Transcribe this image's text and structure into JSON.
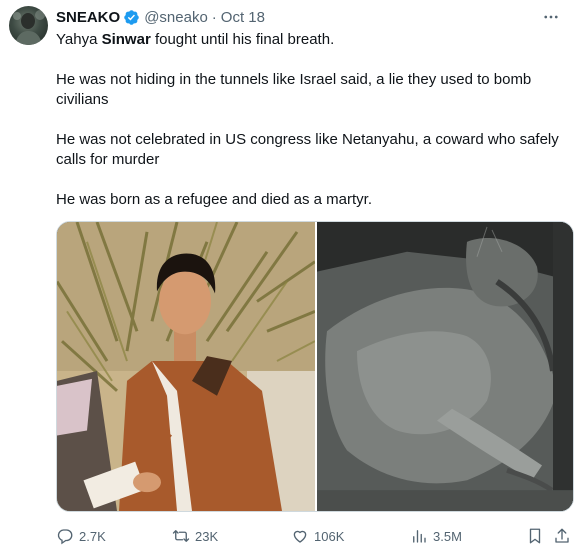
{
  "tweet": {
    "author": {
      "display_name": "SNEAKO",
      "verified_icon": "verified-badge-icon",
      "handle": "@sneako",
      "separator": "·",
      "timestamp": "Oct 18"
    },
    "more_icon": "more-horizontal-icon",
    "body": {
      "line1_prefix": "Yahya ",
      "line1_bold": "Sinwar",
      "line1_suffix": " fought until his final breath.",
      "paragraph2": "He was not hiding in the tunnels like Israel said, a lie they used to bomb civilians",
      "paragraph3": "He was not celebrated in US congress like Netanyahu, a coward who safely calls for murder",
      "paragraph4": "He was born as a refugee and died as a martyr."
    },
    "media": {
      "count": 2
    },
    "actions": {
      "reply": {
        "icon": "reply-icon",
        "count": "2.7K"
      },
      "retweet": {
        "icon": "retweet-icon",
        "count": "23K"
      },
      "like": {
        "icon": "heart-icon",
        "count": "106K"
      },
      "views": {
        "icon": "views-icon",
        "count": "3.5M"
      },
      "bookmark": {
        "icon": "bookmark-icon"
      },
      "share": {
        "icon": "share-icon"
      }
    },
    "colors": {
      "text": "#0f1419",
      "secondary": "#536471",
      "verified": "#1d9bf0",
      "border": "#cfd9de"
    }
  }
}
